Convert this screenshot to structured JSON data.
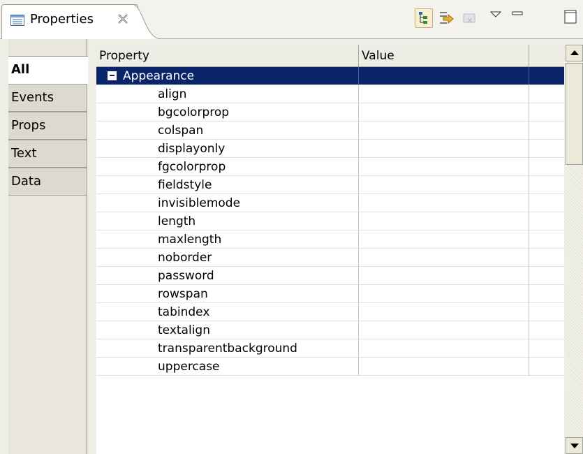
{
  "view": {
    "title": "Properties",
    "icons": {
      "tab": "properties-view-icon",
      "close": "close-icon",
      "tree": "show-categories-icon",
      "filter": "show-advanced-icon",
      "restore": "restore-default-icon",
      "menu": "view-menu-icon",
      "minimize": "minimize-icon",
      "maximize": "maximize-icon"
    }
  },
  "categories": [
    {
      "label": "All",
      "active": true
    },
    {
      "label": "Events",
      "active": false
    },
    {
      "label": "Props",
      "active": false
    },
    {
      "label": "Text",
      "active": false
    },
    {
      "label": "Data",
      "active": false
    }
  ],
  "table": {
    "columns": [
      "Property",
      "Value"
    ],
    "group": "Appearance",
    "rows": [
      "align",
      "bgcolorprop",
      "colspan",
      "displayonly",
      "fgcolorprop",
      "fieldstyle",
      "invisiblemode",
      "length",
      "maxlength",
      "noborder",
      "password",
      "rowspan",
      "tabindex",
      "textalign",
      "transparentbackground",
      "uppercase"
    ]
  },
  "colors": {
    "selection": "#0a246a",
    "background": "#f0efe7"
  }
}
